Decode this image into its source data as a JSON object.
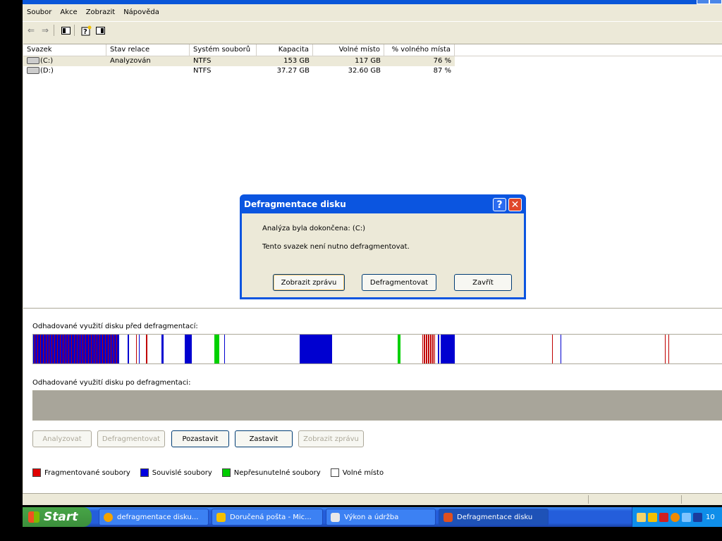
{
  "menu": [
    "Soubor",
    "Akce",
    "Zobrazit",
    "Nápověda"
  ],
  "toolbar": {
    "icons": [
      "back-arrow-icon",
      "forward-arrow-icon",
      "show-hide-console-tree-icon",
      "help-icon",
      "properties-icon"
    ]
  },
  "table": {
    "headers": [
      "Svazek",
      "Stav relace",
      "Systém souborů",
      "Kapacita",
      "Volné místo",
      "% volného místa"
    ],
    "rows": [
      {
        "volume": "(C:)",
        "status": "Analyzován",
        "fs": "NTFS",
        "capacity": "153 GB",
        "free": "117 GB",
        "pct": "76 %"
      },
      {
        "volume": "(D:)",
        "status": "",
        "fs": "NTFS",
        "capacity": "37.27 GB",
        "free": "32.60 GB",
        "pct": "87 %"
      }
    ]
  },
  "analysis": {
    "before_label": "Odhadované využití disku před defragmentací:",
    "after_label": "Odhadované využití disku po defragmentaci:"
  },
  "buttons": {
    "analyze": "Analyzovat",
    "defragment": "Defragmentovat",
    "pause": "Pozastavit",
    "stop": "Zastavit",
    "report": "Zobrazit zprávu"
  },
  "legend": [
    {
      "label": "Fragmentované soubory",
      "color": "#e00000"
    },
    {
      "label": "Souvislé soubory",
      "color": "#0000e0"
    },
    {
      "label": "Nepřesunutelné soubory",
      "color": "#00cc00"
    },
    {
      "label": "Volné místo",
      "color": "#ffffff"
    }
  ],
  "dialog": {
    "title": "Defragmentace disku",
    "line1": "Analýza byla dokončena: (C:)",
    "line2": "Tento svazek není nutno defragmentovat.",
    "btn_report": "Zobrazit zprávu",
    "btn_defrag": "Defragmentovat",
    "btn_close": "Zavřít",
    "help_glyph": "?",
    "close_glyph": "✕"
  },
  "taskbar": {
    "start": "Start",
    "tasks": [
      {
        "label": "defragmentace disku...",
        "icon_color": "#f4a300"
      },
      {
        "label": "Doručená pošta - Mic...",
        "icon_color": "#f4c000"
      },
      {
        "label": "Výkon a údržba",
        "icon_color": "#e8e8e8"
      },
      {
        "label": "Defragmentace disku",
        "icon_color": "#e05020"
      }
    ],
    "clock": "10"
  },
  "disk_map": {
    "colors": {
      "fragmented": "#c00000",
      "contiguous": "#0000d0",
      "unmovable": "#00d000"
    }
  }
}
